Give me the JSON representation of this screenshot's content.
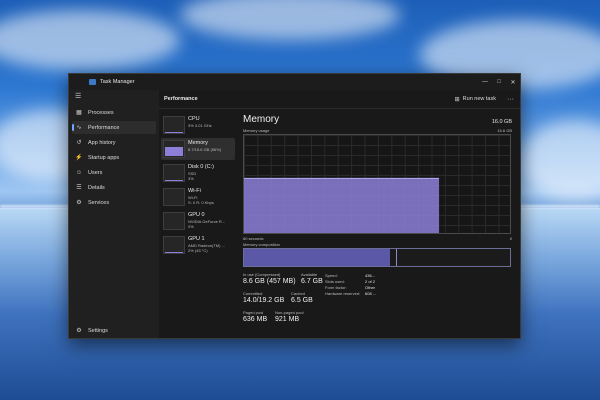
{
  "window": {
    "title": "Task Manager",
    "minimize_icon": "minimize-icon",
    "maximize_icon": "maximize-icon",
    "close_icon": "close-icon"
  },
  "sidebar": {
    "items": [
      {
        "label": "Processes",
        "icon": "processes-icon"
      },
      {
        "label": "Performance",
        "icon": "performance-icon"
      },
      {
        "label": "App history",
        "icon": "history-icon"
      },
      {
        "label": "Startup apps",
        "icon": "startup-icon"
      },
      {
        "label": "Users",
        "icon": "users-icon"
      },
      {
        "label": "Details",
        "icon": "details-icon"
      },
      {
        "label": "Services",
        "icon": "services-icon"
      }
    ],
    "settings_label": "Settings",
    "active_index": 1
  },
  "header": {
    "title": "Performance",
    "run_new_task": "Run new task",
    "more": "···"
  },
  "cards": [
    {
      "title": "CPU",
      "line1": "3% 3.01 GHz",
      "line2": "",
      "fill": 0.03
    },
    {
      "title": "Memory",
      "line1": "8.7/15.6 GB (56%)",
      "line2": "",
      "fill": 0.56
    },
    {
      "title": "Disk 0 (C:)",
      "line1": "SSD",
      "line2": "3%",
      "fill": 0.03
    },
    {
      "title": "Wi-Fi",
      "line1": "Wi-Fi",
      "line2": "S: 0 R: 0 Kbps",
      "fill": 0.0
    },
    {
      "title": "GPU 0",
      "line1": "NVIDIA GeForce R...",
      "line2": "0%",
      "fill": 0.0
    },
    {
      "title": "GPU 1",
      "line1": "AMD Radeon(TM) ...",
      "line2": "2% (45 °C)",
      "fill": 0.02
    }
  ],
  "memory": {
    "title": "Memory",
    "total": "16.0 GB",
    "usage_label": "Memory usage",
    "usage_max": "15.6 GB",
    "time_label": "60 seconds",
    "time_end": "0",
    "composition_label": "Memory composition",
    "in_use_fraction": 0.55,
    "modified_fraction": 0.02,
    "stats": {
      "in_use_label": "In use (Compressed)",
      "in_use_value": "8.6 GB (457 MB)",
      "available_label": "Available",
      "available_value": "6.7 GB",
      "committed_label": "Committed",
      "committed_value": "14.0/19.2 GB",
      "cached_label": "Cached",
      "cached_value": "6.5 GB",
      "paged_label": "Paged pool",
      "paged_value": "636 MB",
      "nonpaged_label": "Non-paged pool",
      "nonpaged_value": "921 MB"
    },
    "details": [
      {
        "label": "Speed:",
        "value": "436..."
      },
      {
        "label": "Slots used:",
        "value": "2 of 2"
      },
      {
        "label": "Form factor:",
        "value": "Other"
      },
      {
        "label": "Hardware reserved:",
        "value": "608 ..."
      }
    ]
  },
  "chart_data": {
    "type": "area",
    "title": "Memory usage",
    "xlabel": "60 seconds",
    "x": [
      0,
      15,
      16,
      60
    ],
    "values": [
      null,
      null,
      8.7,
      8.7
    ],
    "ylim": [
      0,
      15.6
    ],
    "color": "#8c7fd8"
  }
}
